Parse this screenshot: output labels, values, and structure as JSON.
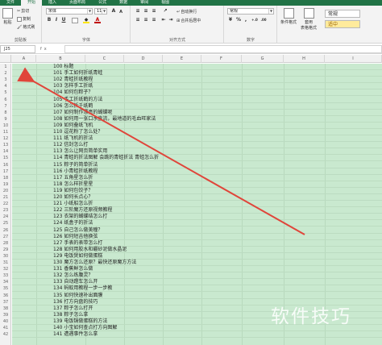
{
  "tabs": [
    {
      "label": "文件",
      "active": false
    },
    {
      "label": "开始",
      "active": true
    },
    {
      "label": "插入",
      "active": false
    },
    {
      "label": "页面布局",
      "active": false
    },
    {
      "label": "公式",
      "active": false
    },
    {
      "label": "数据",
      "active": false
    },
    {
      "label": "审阅",
      "active": false
    },
    {
      "label": "视图",
      "active": false
    }
  ],
  "ribbon": {
    "clipboard": {
      "paste": "粘贴",
      "cut": "剪切",
      "copy": "复制",
      "format_painter": "格式刷",
      "label": "剪贴板"
    },
    "font": {
      "name": "宋体",
      "size": "11",
      "bold": "B",
      "italic": "I",
      "underline": "U",
      "label": "字体"
    },
    "alignment": {
      "wrap": "自动换行",
      "merge": "合并后居中",
      "label": "对齐方式"
    },
    "number": {
      "format": "常规",
      "percent": "%",
      "comma": ",",
      "label": "数字"
    },
    "styles": {
      "conditional": "条件格式",
      "table": "套用\n表格格式",
      "normal": "常规",
      "good": "适中"
    },
    "accent_green": "#217346",
    "cell_fill": "#c9e9cf",
    "arrow_color": "#e0453a"
  },
  "formula_bar": {
    "name_box": "J25",
    "fx": "fx",
    "value": ""
  },
  "columns": [
    "A",
    "B",
    "C",
    "D",
    "E",
    "F",
    "G",
    "H",
    "I"
  ],
  "rows": [
    {
      "n": "1",
      "text": "100 标题"
    },
    {
      "n": "2",
      "text": "101 手工如何折纸青蛙"
    },
    {
      "n": "3",
      "text": "102 青蛙折纸教程"
    },
    {
      "n": "4",
      "text": "103 怎样手工折纸"
    },
    {
      "n": "5",
      "text": "104 如何包粽子？"
    },
    {
      "n": "6",
      "text": "105 手工折纸鹤的方法"
    },
    {
      "n": "7",
      "text": "106 怎么折千纸鹤"
    },
    {
      "n": "8",
      "text": "107 如何制作漂亮的蝴蝶呢"
    },
    {
      "n": "9",
      "text": "108 如何用一张口水直流，最地道的毛血旺家法"
    },
    {
      "n": "10",
      "text": "109 如何叠纸飞机"
    },
    {
      "n": "11",
      "text": "110 逗花粉了怎么处？"
    },
    {
      "n": "12",
      "text": "111 纸飞机的折法"
    },
    {
      "n": "13",
      "text": "112 信封怎么打"
    },
    {
      "n": "14",
      "text": "113 怎么让网页简单实用"
    },
    {
      "n": "15",
      "text": "114 青蛙的折法图解 会跳的青蛙折法 青蛙怎么折"
    },
    {
      "n": "16",
      "text": "115 粽子的简单折法"
    },
    {
      "n": "17",
      "text": "116 小青蛙折纸教程"
    },
    {
      "n": "18",
      "text": "117 五角星怎么折"
    },
    {
      "n": "19",
      "text": "118 怎么样折星星"
    },
    {
      "n": "20",
      "text": "119 如何包饺子？"
    },
    {
      "n": "21",
      "text": "120 如何长点心？"
    },
    {
      "n": "22",
      "text": "121 小纸船怎么折"
    },
    {
      "n": "23",
      "text": "122 三阶魔方还原视频教程"
    },
    {
      "n": "24",
      "text": "123 衣架的蝴蝶结怎么打"
    },
    {
      "n": "25",
      "text": "124 纸盒子的折法"
    },
    {
      "n": "26",
      "text": "125 自己怎么做美瞳？"
    },
    {
      "n": "27",
      "text": "126 如何短吉他换弦"
    },
    {
      "n": "28",
      "text": "127 手表的表带怎么打"
    },
    {
      "n": "29",
      "text": "128 如何用胶水和硼砂泥做水晶泥"
    },
    {
      "n": "30",
      "text": "129 电饭煲如何做蛋糕"
    },
    {
      "n": "31",
      "text": "130 魔方怎么还原？最快还原魔方方法"
    },
    {
      "n": "32",
      "text": "131 香蕉鲜怎么做"
    },
    {
      "n": "33",
      "text": "132 怎么练腹灵？"
    },
    {
      "n": "34",
      "text": "133 自动蹬车怎么开"
    },
    {
      "n": "35",
      "text": "134 蚂蚁用教程一步一步教"
    },
    {
      "n": "36",
      "text": "135 如何快速补出面膜"
    },
    {
      "n": "37",
      "text": "136 打方向盘的技巧"
    },
    {
      "n": "38",
      "text": "137 粽子怎么打开"
    },
    {
      "n": "39",
      "text": "138 粽子怎么拿"
    },
    {
      "n": "40",
      "text": "139 电饭锅做蛋糕的方法"
    },
    {
      "n": "41",
      "text": "140 小宝如何查点打方向图解"
    },
    {
      "n": "42",
      "text": "141 遭遇事件怎么拿"
    }
  ],
  "watermark": "软件技巧"
}
